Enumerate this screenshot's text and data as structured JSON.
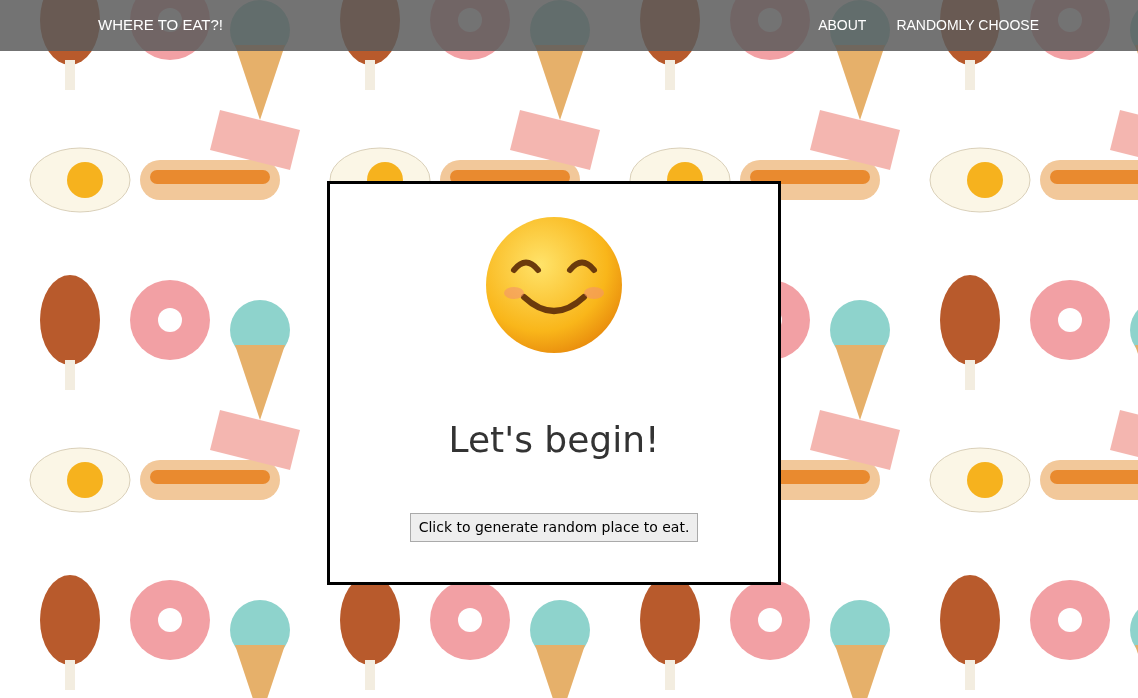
{
  "navbar": {
    "brand": "WHERE TO EAT?!",
    "links": [
      "ABOUT",
      "RANDOMLY CHOOSE"
    ]
  },
  "card": {
    "heading": "Let's begin!",
    "button": "Click to generate random place to eat."
  }
}
